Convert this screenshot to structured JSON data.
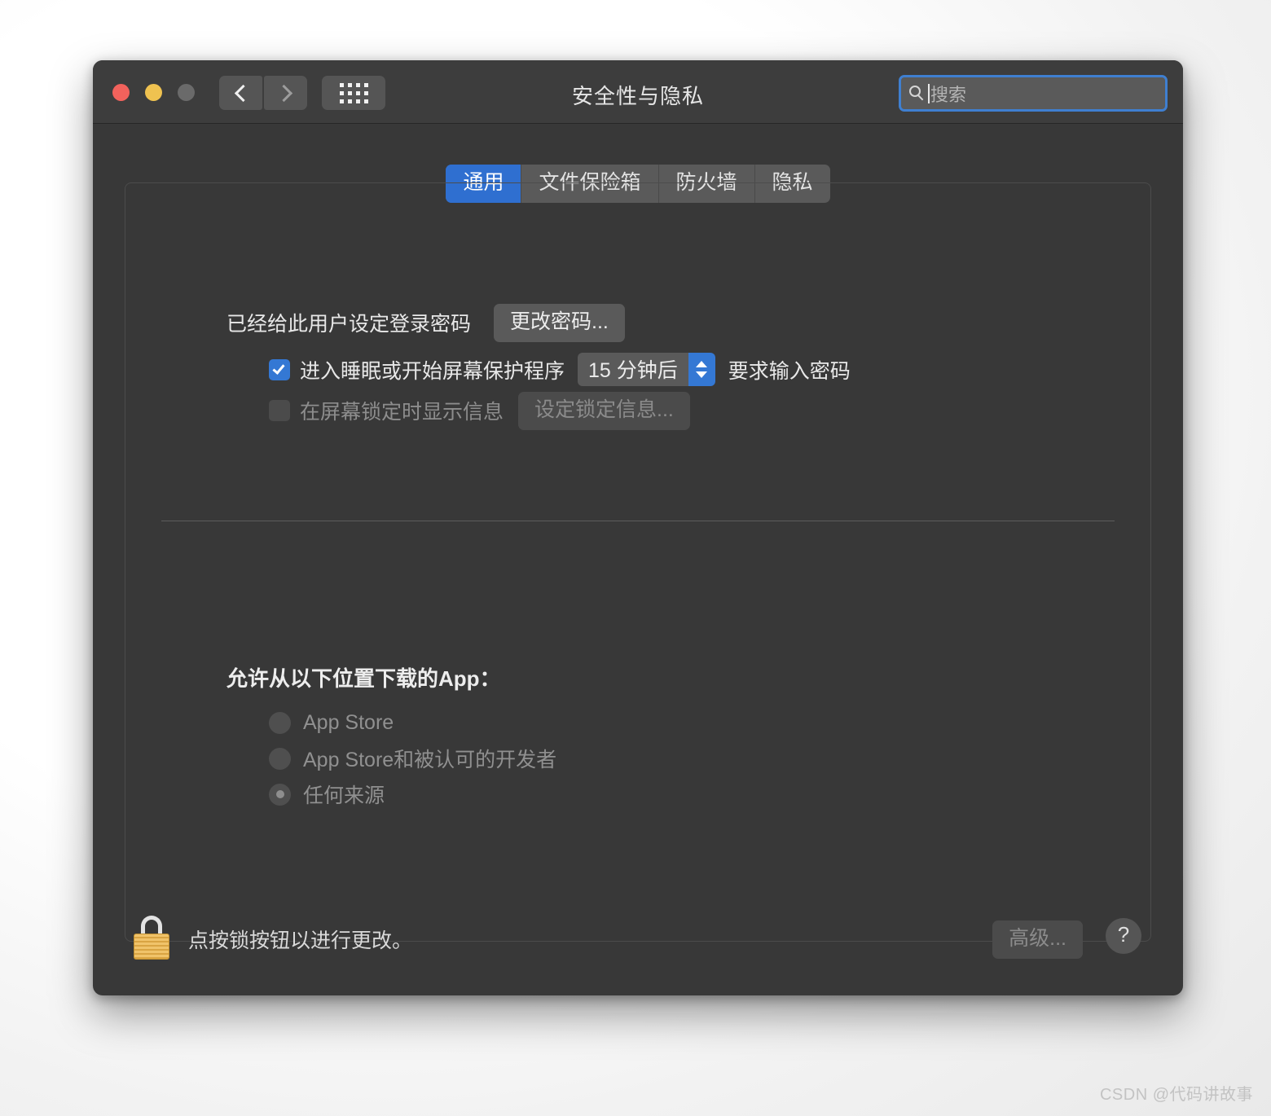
{
  "window": {
    "title": "安全性与隐私",
    "traffic_lights": [
      "close",
      "minimize",
      "zoom"
    ],
    "nav": {
      "back_icon": "chevron-left-icon",
      "forward_icon": "chevron-right-icon",
      "grid_icon": "grid-view-icon"
    },
    "search": {
      "placeholder": "搜索",
      "value": "",
      "icon": "search-icon"
    }
  },
  "tabs": [
    {
      "label": "通用",
      "active": true
    },
    {
      "label": "文件保险箱",
      "active": false
    },
    {
      "label": "防火墙",
      "active": false
    },
    {
      "label": "隐私",
      "active": false
    }
  ],
  "general": {
    "password_status_label": "已经给此用户设定登录密码",
    "change_password_button": "更改密码...",
    "sleep_checkbox_label": "进入睡眠或开始屏幕保护程序",
    "sleep_checkbox_checked": true,
    "delay_value": "15 分钟后",
    "require_password_label": "要求输入密码",
    "lock_message_checkbox_label": "在屏幕锁定时显示信息",
    "lock_message_checkbox_checked": false,
    "set_lock_message_button": "设定锁定信息..."
  },
  "downloads": {
    "section_title": "允许从以下位置下载的App：",
    "options": [
      {
        "label": "App Store",
        "selected": false
      },
      {
        "label": "App Store和被认可的开发者",
        "selected": false
      },
      {
        "label": "任何来源",
        "selected": true
      }
    ]
  },
  "footer": {
    "lock_icon": "padlock-closed-icon",
    "lock_text": "点按锁按钮以进行更改。",
    "advanced_button": "高级...",
    "help_button": "?"
  },
  "watermark": "CSDN @代码讲故事",
  "colors": {
    "accent_blue": "#3478d4",
    "tab_active_blue": "#2f6fd0",
    "window_bg": "#383838",
    "titlebar_bg": "#3d3d3d",
    "control_bg": "#5a5a5a",
    "lock_gold": "#e8b55a"
  }
}
